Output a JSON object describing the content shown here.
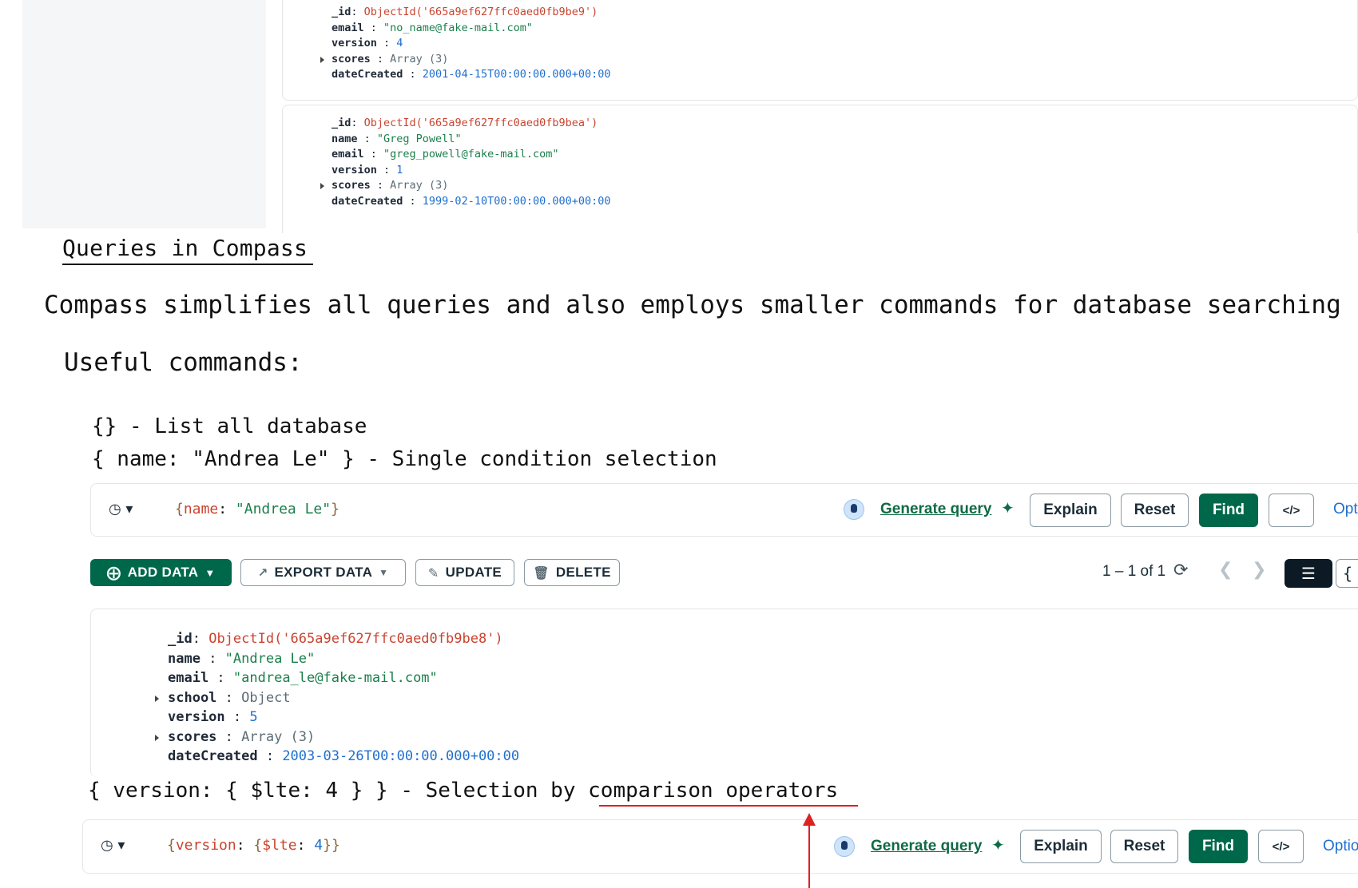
{
  "top_documents": [
    {
      "fields": [
        {
          "key": "_id",
          "sep": ": ",
          "value": "ObjectId('665a9ef627ffc0aed0fb9be9')",
          "kind": "objectid"
        },
        {
          "key": "email",
          "sep": " : ",
          "value": "\"no_name@fake-mail.com\"",
          "kind": "string"
        },
        {
          "key": "version",
          "sep": " : ",
          "value": "4",
          "kind": "number"
        },
        {
          "key": "scores",
          "sep": " : ",
          "value": "Array (3)",
          "kind": "array"
        },
        {
          "key": "dateCreated",
          "sep": " : ",
          "value": "2001-04-15T00:00:00.000+00:00",
          "kind": "date"
        }
      ]
    },
    {
      "fields": [
        {
          "key": "_id",
          "sep": ": ",
          "value": "ObjectId('665a9ef627ffc0aed0fb9bea')",
          "kind": "objectid"
        },
        {
          "key": "name",
          "sep": " : ",
          "value": "\"Greg Powell\"",
          "kind": "string"
        },
        {
          "key": "email",
          "sep": " : ",
          "value": "\"greg_powell@fake-mail.com\"",
          "kind": "string"
        },
        {
          "key": "version",
          "sep": " : ",
          "value": "1",
          "kind": "number"
        },
        {
          "key": "scores",
          "sep": " : ",
          "value": "Array (3)",
          "kind": "array"
        },
        {
          "key": "dateCreated",
          "sep": " : ",
          "value": "1999-02-10T00:00:00.000+00:00",
          "kind": "date"
        }
      ]
    }
  ],
  "heading": "Queries in Compass",
  "intro": "Compass simplifies all queries and also employs smaller commands for database searching",
  "useful_label": "Useful commands:",
  "commands": [
    "{} - List all database",
    "{ name: \"Andrea Le\" } - Single condition selection"
  ],
  "query1": {
    "open": "{",
    "key": "name",
    "colon": ": ",
    "value": "\"Andrea Le\"",
    "close": "}"
  },
  "query_bar": {
    "generate": "Generate query",
    "explain": "Explain",
    "reset": "Reset",
    "find": "Find",
    "code": "</>",
    "options1": "Opt",
    "options2": "Optio"
  },
  "toolbar": {
    "add_data": "ADD DATA",
    "export_data": "EXPORT DATA",
    "update": "UPDATE",
    "delete": "DELETE",
    "pagination": "1 – 1 of 1"
  },
  "result_document": {
    "fields": [
      {
        "key": "_id",
        "sep": ": ",
        "value": "ObjectId('665a9ef627ffc0aed0fb9be8')",
        "kind": "objectid"
      },
      {
        "key": "name",
        "sep": " : ",
        "value": "\"Andrea Le\"",
        "kind": "string"
      },
      {
        "key": "email",
        "sep": " : ",
        "value": "\"andrea_le@fake-mail.com\"",
        "kind": "string"
      },
      {
        "key": "school",
        "sep": " : ",
        "value": "Object",
        "kind": "object"
      },
      {
        "key": "version",
        "sep": " : ",
        "value": "5",
        "kind": "number"
      },
      {
        "key": "scores",
        "sep": " : ",
        "value": "Array (3)",
        "kind": "array"
      },
      {
        "key": "dateCreated",
        "sep": " : ",
        "value": "2003-03-26T00:00:00.000+00:00",
        "kind": "date"
      }
    ]
  },
  "command3": {
    "prefix": "{ version: { $lte: 4 } } - Selection by ",
    "highlight": "comparison operators"
  },
  "query2": {
    "open": "{",
    "key": "version",
    "colon": ": ",
    "inner_open": "{",
    "op": "$lte",
    "op_colon": ": ",
    "value": "4",
    "close": "}}"
  },
  "colors": {
    "brand_green": "#00684a",
    "objectid_red": "#c9442f",
    "string_green": "#1a7f4b",
    "number_blue": "#1f6fd0",
    "annotation_red": "#dd2222"
  }
}
